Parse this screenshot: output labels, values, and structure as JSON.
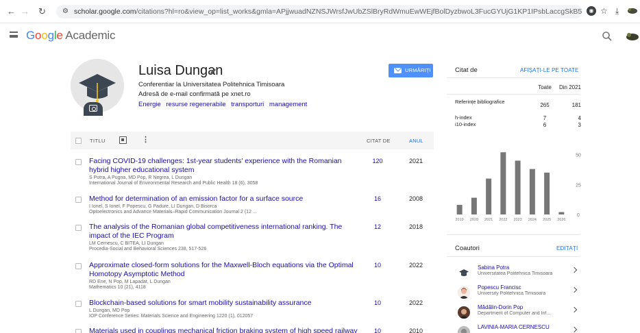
{
  "browser": {
    "url_host": "scholar.google.com",
    "url_rest": "/citations?hl=ro&view_op=list_works&gmla=APjjwuadNZNSJWrsfJwUbZSlBryRdWmuEwWEjfBolDyzbwoL3FucGYUjG1KP1IPsbLaccgSkB5nyFzvO8H15C04XqI5wXJUT&user..."
  },
  "header": {
    "logo_g": "G",
    "logo_o1": "o",
    "logo_o2": "o",
    "logo_g2": "g",
    "logo_l": "l",
    "logo_e": "e",
    "logo_suffix": "Academic"
  },
  "profile": {
    "name": "Luisa Dungan",
    "affiliation": "Conferentiar la Universitatea Politehnica Timisoara",
    "email": "Adresă de e-mail confirmată pe xnet.ro",
    "interests": [
      "Energie",
      "resurse regenerabile",
      "transporturi",
      "management"
    ],
    "follow_label": "URMĂRIȚI"
  },
  "table": {
    "col_title": "TITLU",
    "col_cited": "CITAT DE",
    "col_year": "ANUL"
  },
  "articles": [
    {
      "title": "Facing COVID-19 challenges: 1st-year students' experience with the Romanian hybrid higher educational system",
      "authors": "S Potra, A Pugna, MD Pop, R Negrea, L Dungan",
      "venue": "International Journal of Environmental Research and Public Health 18 (6), 3058",
      "cited": "120",
      "year": "2021"
    },
    {
      "title": "Method for determination of an emission factor for a surface source",
      "authors": "I Ionel, S Ionel, F Popescu, G Padure, LI Dungan, D Bisorca",
      "venue": "Optoelectronics and Advance Materials–Rapid Communication Journal 2 (12 ...",
      "cited": "16",
      "year": "2008"
    },
    {
      "title": "The analysis of the Romanian global competitiveness international ranking. The impact of the IEC Program",
      "authors": "LM Cernescu, C BITEA, LI Dungan",
      "venue": "Procedia-Social and Behavioral Sciences 238, 517-526",
      "cited": "12",
      "year": "2018"
    },
    {
      "title": "Approximate closed-form solutions for the Maxwell-Bloch equations via the Optimal Homotopy Asymptotic Method",
      "authors": "RD Ene, N Pop, M Lapadat, L Dungan",
      "venue": "Mathematics 10 (21), 4118",
      "cited": "10",
      "year": "2022"
    },
    {
      "title": "Blockchain-based solutions for smart mobility sustainability assurance",
      "authors": "L Dungan, MD Pop",
      "venue": "IOP Conference Series: Materials Science and Engineering 1220 (1), 012057",
      "cited": "10",
      "year": "2022"
    },
    {
      "title": "Materials used in couplings mechanical friction braking system of high speed railway",
      "authors": "",
      "venue": "",
      "cited": "10",
      "year": "2010"
    }
  ],
  "citations": {
    "label": "Citat de",
    "see_all": "AFIȘAȚI-LE PE TOATE",
    "col_all": "Toate",
    "col_since": "Din 2021",
    "rows": [
      {
        "label": "Referințe bibliografice",
        "all": "265",
        "since": "181"
      },
      {
        "label": "h-index",
        "all": "7",
        "since": "4"
      },
      {
        "label": "i10-index",
        "all": "6",
        "since": "3"
      }
    ]
  },
  "chart_data": {
    "type": "bar",
    "categories": [
      "2019",
      "2020",
      "2021",
      "2022",
      "2023",
      "2024",
      "2025",
      "2026"
    ],
    "values": [
      8,
      14,
      30,
      52,
      45,
      38,
      35,
      2
    ],
    "ylim": [
      0,
      55
    ],
    "yticks": [
      "50",
      "25",
      "0"
    ],
    "bar_color": "#777777"
  },
  "coauthors": {
    "label": "Coautori",
    "edit_label": "EDITAȚI",
    "items": [
      {
        "name": "Sabina Potra",
        "affiliation": "Universitatea Politehnica Timisoara"
      },
      {
        "name": "Popescu Francisc",
        "affiliation": "University Politehnica Timisoara"
      },
      {
        "name": "Mădălin-Dorin Pop",
        "affiliation": "Department of Computer and Inf..."
      },
      {
        "name": "LAVINIA-MARIA CERNESCU",
        "affiliation": ""
      }
    ]
  }
}
